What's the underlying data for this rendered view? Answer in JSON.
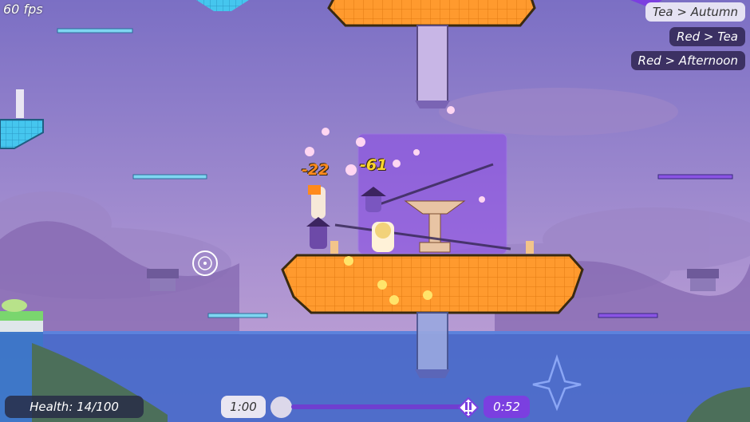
{
  "hud": {
    "fps": "60 fps",
    "health": "Health: 14/100",
    "timer_left": "1:00",
    "timer_right": "0:52"
  },
  "kill_feed": [
    "Tea > Autumn",
    "Red > Tea",
    "Red > Afternoon"
  ],
  "damage": [
    "-22",
    "-61"
  ],
  "colors": {
    "sky_top": "#7a6fc2",
    "sky_bottom": "#c6a6d8",
    "water": "#3f66c8",
    "platform_orange": "#ff9a2e",
    "accent_purple": "#7b3fe0"
  },
  "icons": [
    "crosshair-icon",
    "alert-icon",
    "star-outline-icon"
  ]
}
